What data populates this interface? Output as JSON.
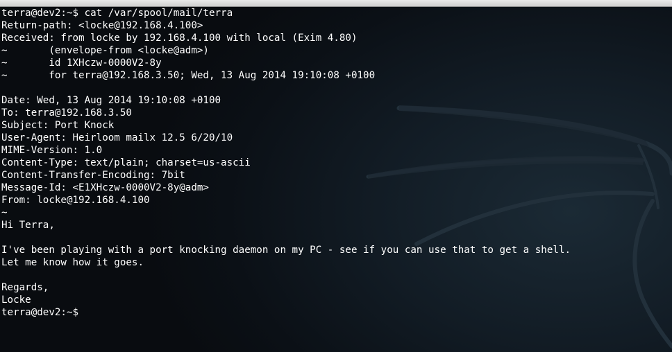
{
  "terminal": {
    "lines": [
      "terra@dev2:~$ cat /var/spool/mail/terra",
      "Return-path: <locke@192.168.4.100>",
      "Received: from locke by 192.168.4.100 with local (Exim 4.80)",
      "~       (envelope-from <locke@adm>)",
      "~       id 1XHczw-0000V2-8y",
      "~       for terra@192.168.3.50; Wed, 13 Aug 2014 19:10:08 +0100",
      "",
      "Date: Wed, 13 Aug 2014 19:10:08 +0100",
      "To: terra@192.168.3.50",
      "Subject: Port Knock",
      "User-Agent: Heirloom mailx 12.5 6/20/10",
      "MIME-Version: 1.0",
      "Content-Type: text/plain; charset=us-ascii",
      "Content-Transfer-Encoding: 7bit",
      "Message-Id: <E1XHczw-0000V2-8y@adm>",
      "From: locke@192.168.4.100",
      "~",
      "Hi Terra,",
      "",
      "I've been playing with a port knocking daemon on my PC - see if you can use that to get a shell.",
      "Let me know how it goes.",
      "",
      "Regards,",
      "Locke",
      "terra@dev2:~$ "
    ]
  },
  "colors": {
    "text": "#ffffff",
    "background": "#0b0f14",
    "watermark": "#2c3944"
  }
}
